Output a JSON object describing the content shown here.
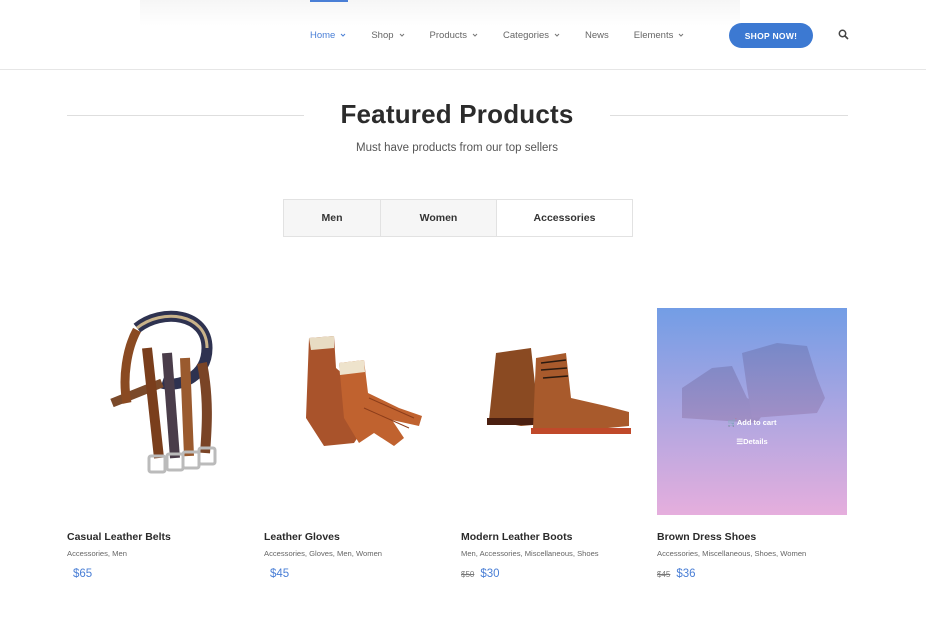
{
  "nav": {
    "items": [
      {
        "label": "Home",
        "dropdown": true,
        "active": true
      },
      {
        "label": "Shop",
        "dropdown": true
      },
      {
        "label": "Products",
        "dropdown": true
      },
      {
        "label": "Categories",
        "dropdown": true
      },
      {
        "label": "News",
        "dropdown": false
      },
      {
        "label": "Elements",
        "dropdown": true
      }
    ],
    "cta_label": "SHOP NOW!",
    "search_icon": "search-icon"
  },
  "section": {
    "title": "Featured Products",
    "subtitle": "Must have products from our top sellers"
  },
  "tabs": [
    {
      "label": "Men"
    },
    {
      "label": "Women"
    },
    {
      "label": "Accessories"
    }
  ],
  "products": [
    {
      "name": "Casual Leather Belts",
      "categories": "Accessories, Men",
      "old_price": "",
      "price": "$65",
      "image": "belts"
    },
    {
      "name": "Leather Gloves",
      "categories": "Accessories, Gloves, Men, Women",
      "old_price": "",
      "price": "$45",
      "image": "gloves"
    },
    {
      "name": "Modern Leather Boots",
      "categories": "Men, Accessories, Miscellaneous, Shoes",
      "old_price": "$50",
      "price": "$30",
      "image": "boots"
    },
    {
      "name": "Brown Dress Shoes",
      "categories": "Accessories, Miscellaneous, Shoes, Women",
      "old_price": "$45",
      "price": "$36",
      "image": "dress-shoes"
    }
  ],
  "hover": {
    "add_to_cart": "Add to cart",
    "details": "Details"
  },
  "colors": {
    "accent": "#3c79d2",
    "price": "#4a7fd6",
    "overlay_top": "#5a8ce1",
    "overlay_bottom": "#e1a0d7"
  }
}
